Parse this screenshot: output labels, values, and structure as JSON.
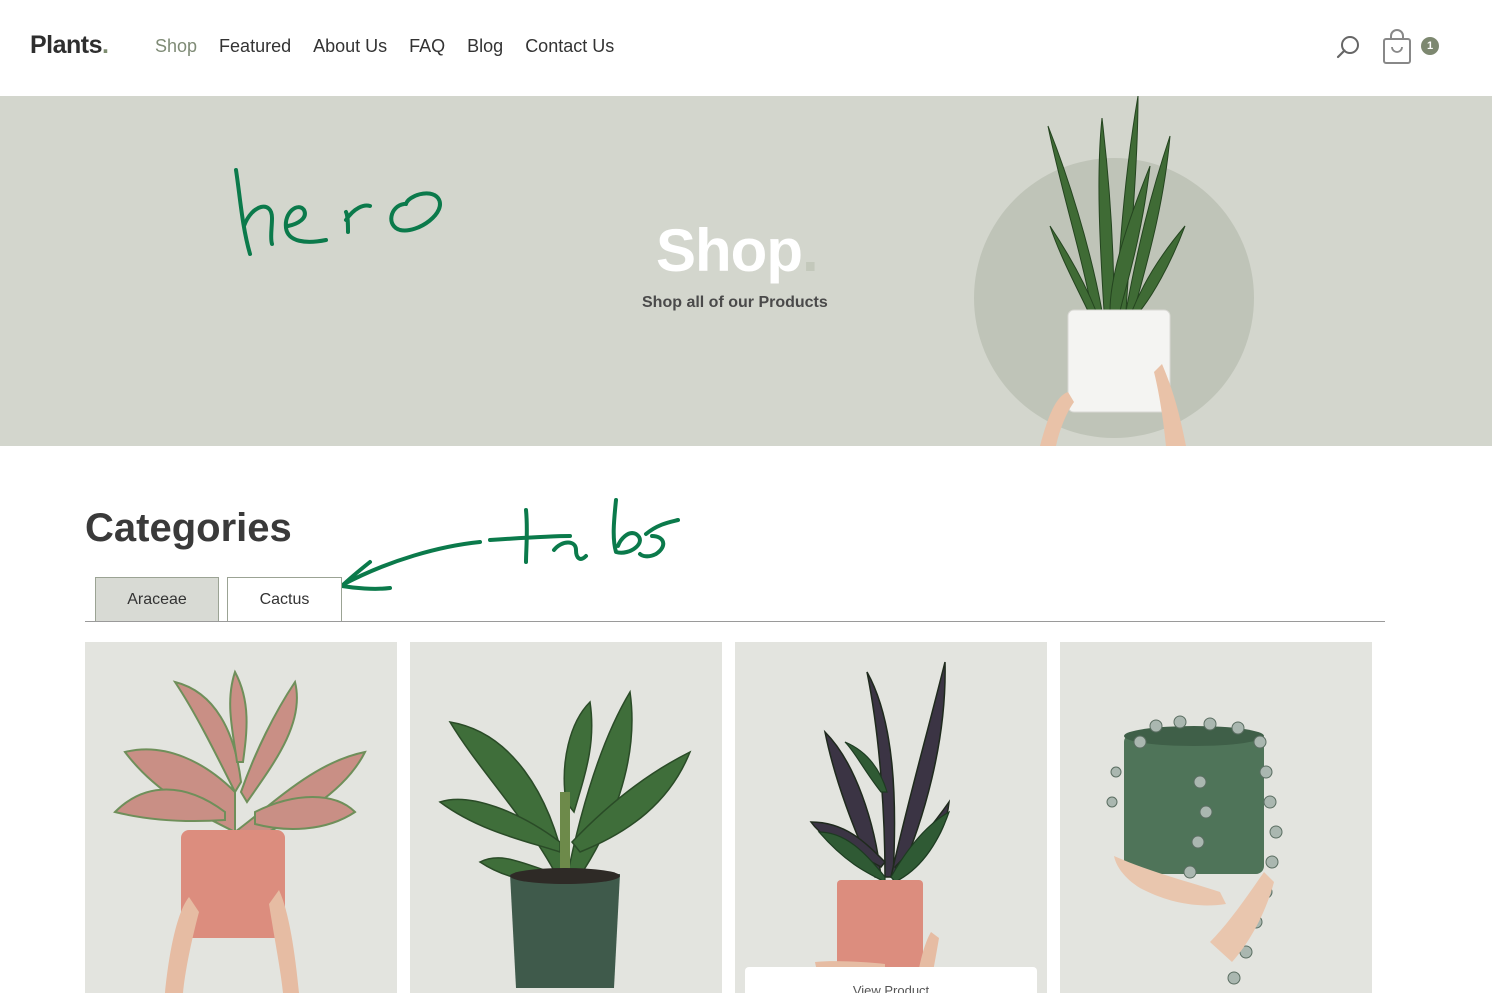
{
  "header": {
    "logo": "Plants",
    "logo_dot": ".",
    "nav": [
      "Shop",
      "Featured",
      "About Us",
      "FAQ",
      "Blog",
      "Contact Us"
    ],
    "active_nav": "Shop",
    "cart_count": "1"
  },
  "hero": {
    "title": "Shop",
    "title_dot": ".",
    "subtitle": "Shop all of our Products",
    "annotation": "hero"
  },
  "categories": {
    "title": "Categories",
    "tabs": [
      "Araceae",
      "Cactus"
    ],
    "active_tab": "Araceae",
    "annotation": "tabs"
  },
  "products": {
    "view_label": "View Product"
  },
  "colors": {
    "accent": "#7d8870",
    "hero_bg": "#d3d6cd",
    "card_bg": "#e3e4df",
    "annotation_ink": "#0b7a4b"
  }
}
